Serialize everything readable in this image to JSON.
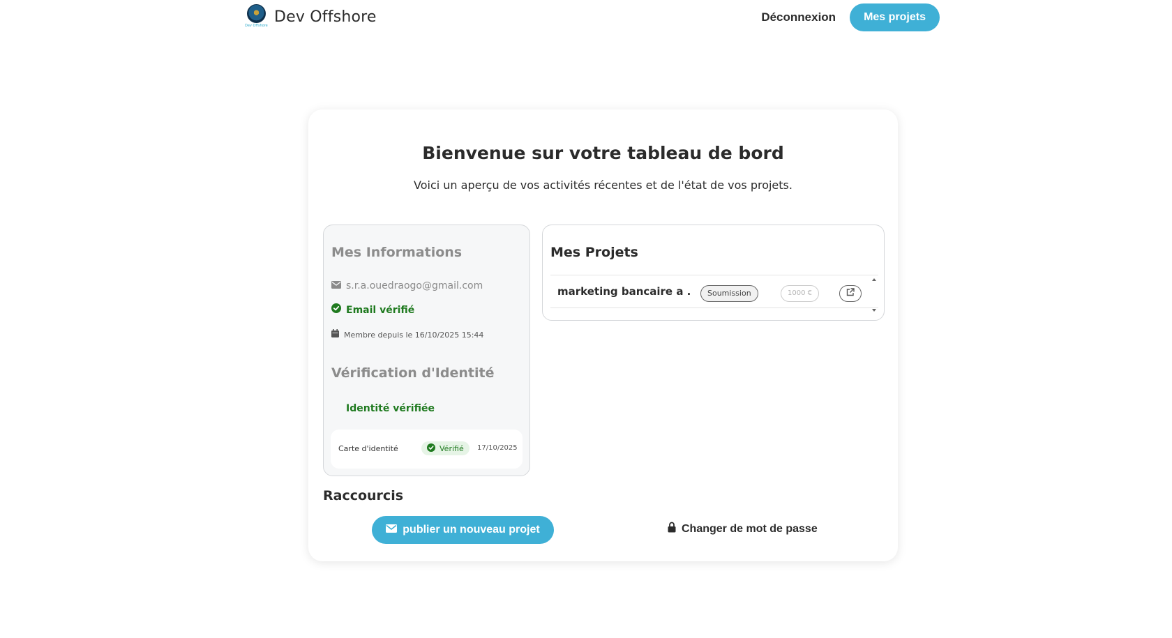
{
  "header": {
    "brand_name": "Dev Offshore",
    "logo_caption": "Dev Offshore",
    "logout_label": "Déconnexion",
    "projects_button_label": "Mes projets"
  },
  "colors": {
    "accent": "#3fb0d6",
    "success": "#1f7a1f"
  },
  "dashboard": {
    "title": "Bienvenue sur votre tableau de bord",
    "subtitle": "Voici un aperçu de vos activités récentes et de l'état de vos projets."
  },
  "info": {
    "heading": "Mes Informations",
    "email": "s.r.a.ouedraogo@gmail.com",
    "email_status": "Email vérifié",
    "member_since": "Membre depuis le 16/10/2025 15:44",
    "identity_heading": "Vérification d'Identité",
    "identity_status": "Identité vérifiée",
    "document": {
      "name": "Carte d'identité",
      "status": "Vérifié",
      "date": "17/10/2025"
    }
  },
  "projects": {
    "heading": "Mes Projets",
    "items": [
      {
        "name": "marketing bancaire a ...",
        "status": "Soumission",
        "price": "1000 €"
      }
    ]
  },
  "shortcuts": {
    "heading": "Raccourcis",
    "publish_label": "publier un nouveau projet",
    "password_label": "Changer de mot de passe"
  },
  "icons": {
    "email": "envelope-icon",
    "verified": "check-circle-icon",
    "calendar": "calendar-icon",
    "open": "external-link-icon",
    "lock": "lock-icon"
  }
}
